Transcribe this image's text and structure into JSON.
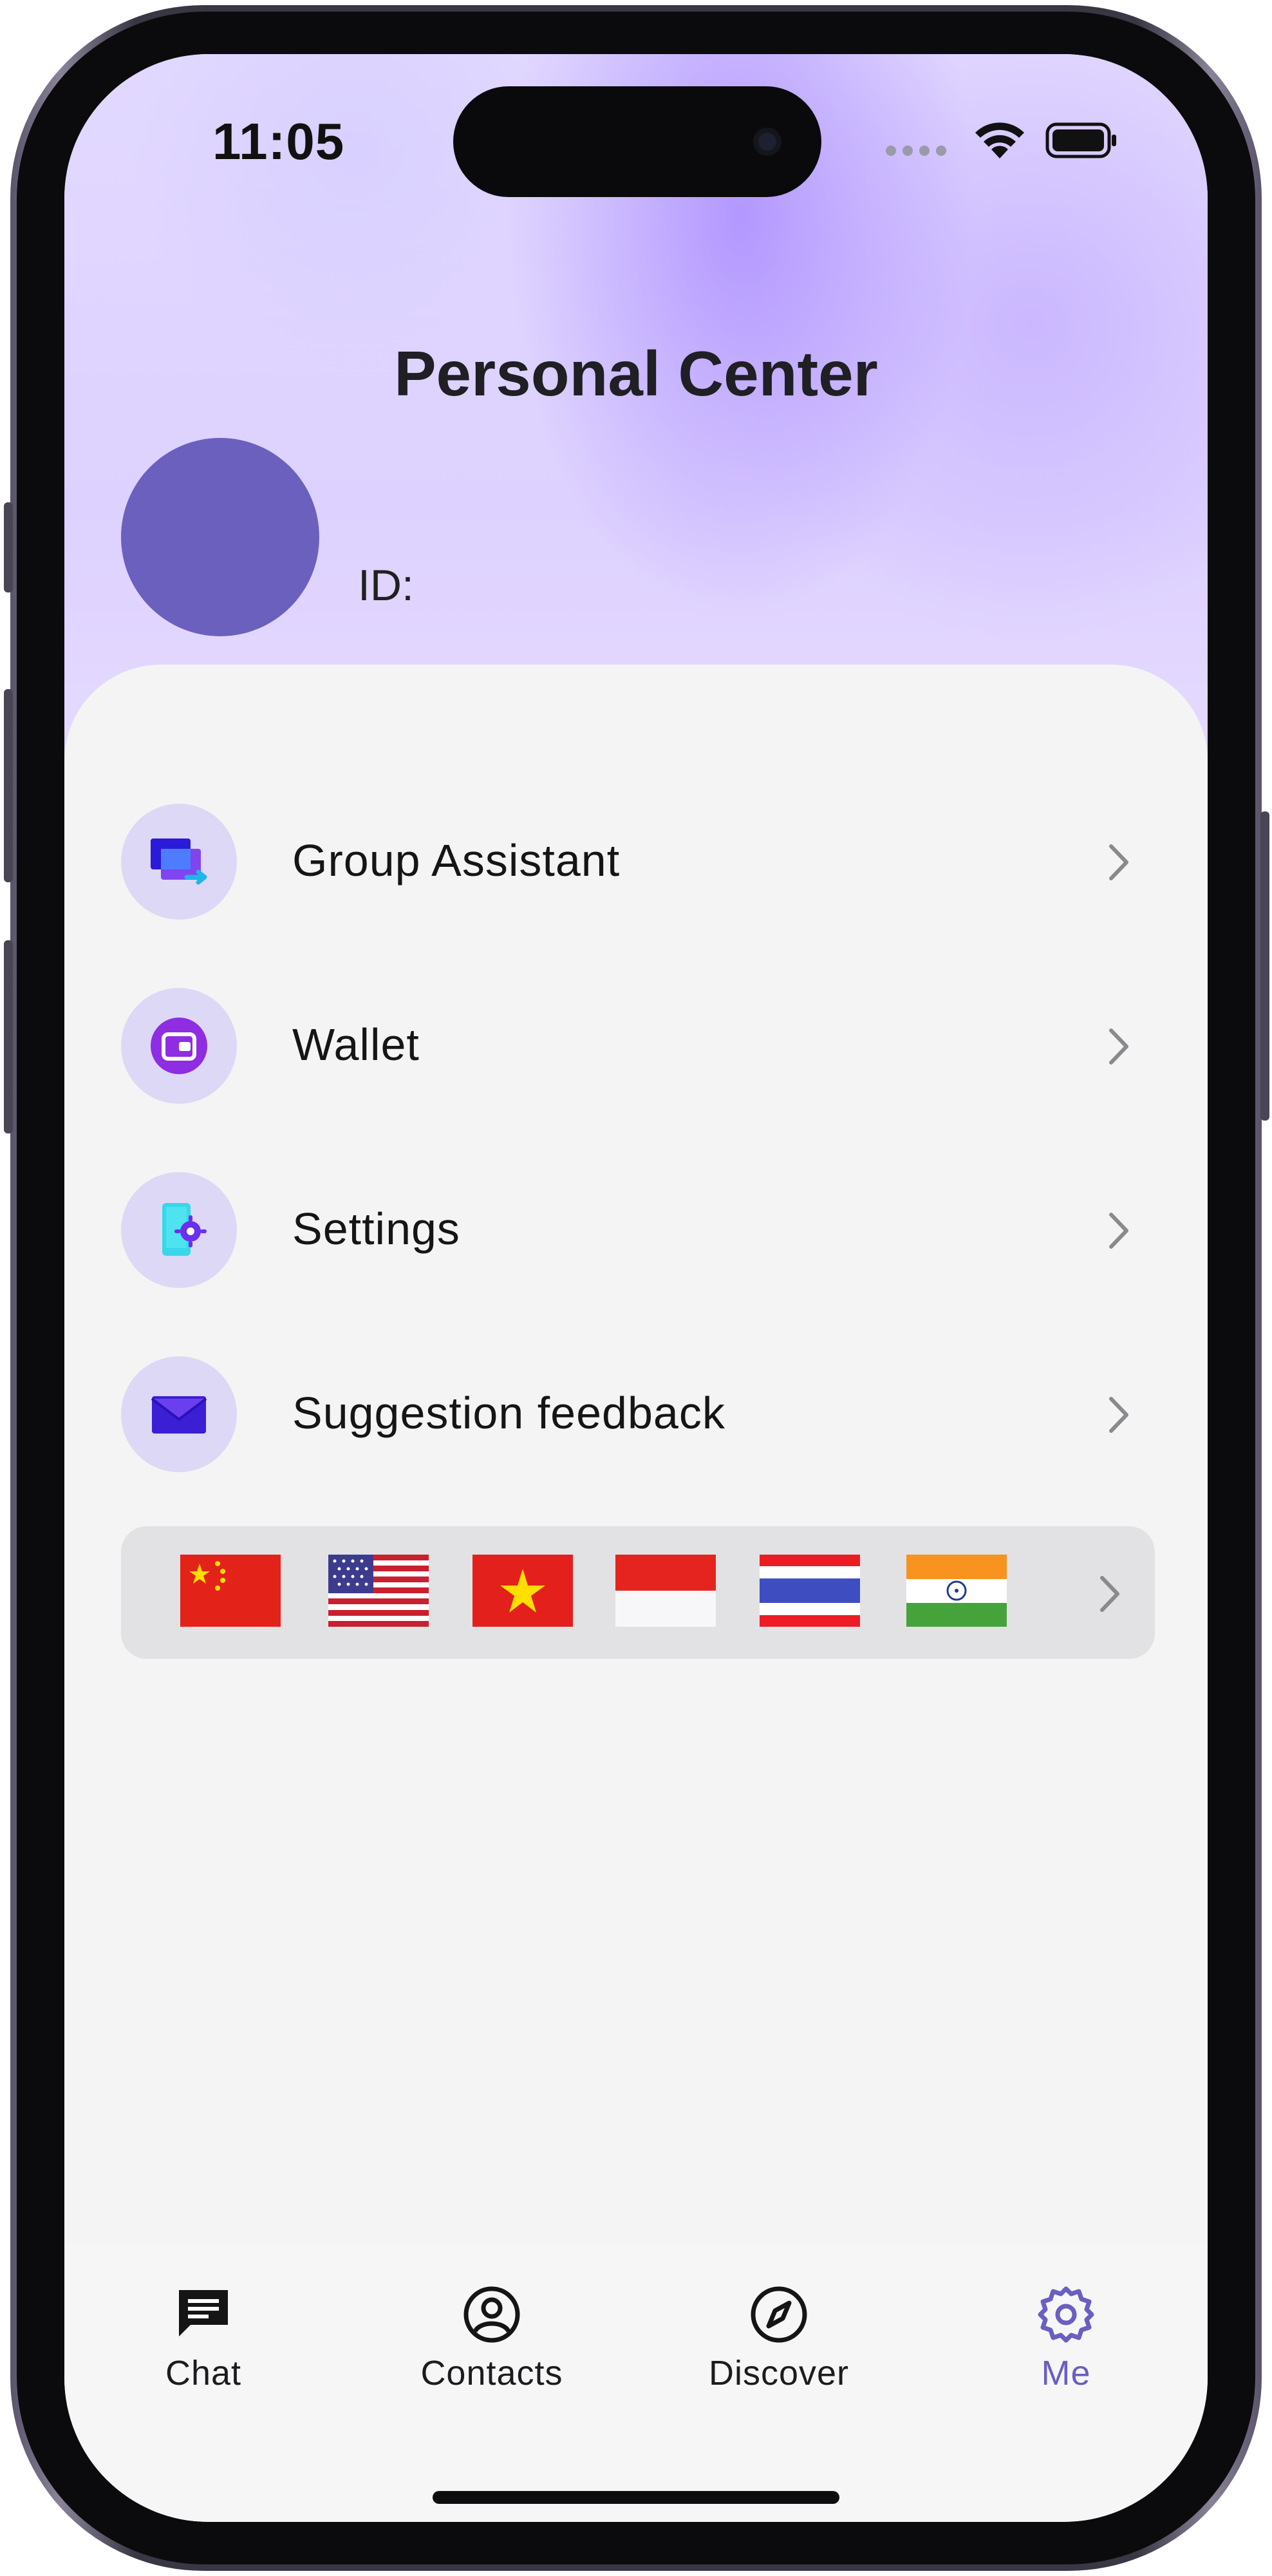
{
  "status_bar": {
    "time": "11:05"
  },
  "header": {
    "title": "Personal Center",
    "id_label": "ID:"
  },
  "menu": {
    "items": [
      {
        "label": "Group Assistant",
        "icon": "group-assistant-icon"
      },
      {
        "label": "Wallet",
        "icon": "wallet-icon"
      },
      {
        "label": "Settings",
        "icon": "settings-phone-icon"
      },
      {
        "label": "Suggestion feedback",
        "icon": "envelope-icon"
      }
    ]
  },
  "languages": {
    "flags": [
      "china-flag",
      "usa-flag",
      "vietnam-flag",
      "indonesia-flag",
      "thailand-flag",
      "india-flag"
    ]
  },
  "tabbar": {
    "tabs": [
      {
        "label": "Chat",
        "icon": "chat-icon",
        "active": false
      },
      {
        "label": "Contacts",
        "icon": "contacts-icon",
        "active": false
      },
      {
        "label": "Discover",
        "icon": "compass-icon",
        "active": false
      },
      {
        "label": "Me",
        "icon": "gear-icon",
        "active": true
      }
    ]
  },
  "colors": {
    "accent": "#6a5fc1",
    "avatar": "#6b60be",
    "icon_circle": "#ddd8f5",
    "background": "#f4f4f5"
  }
}
